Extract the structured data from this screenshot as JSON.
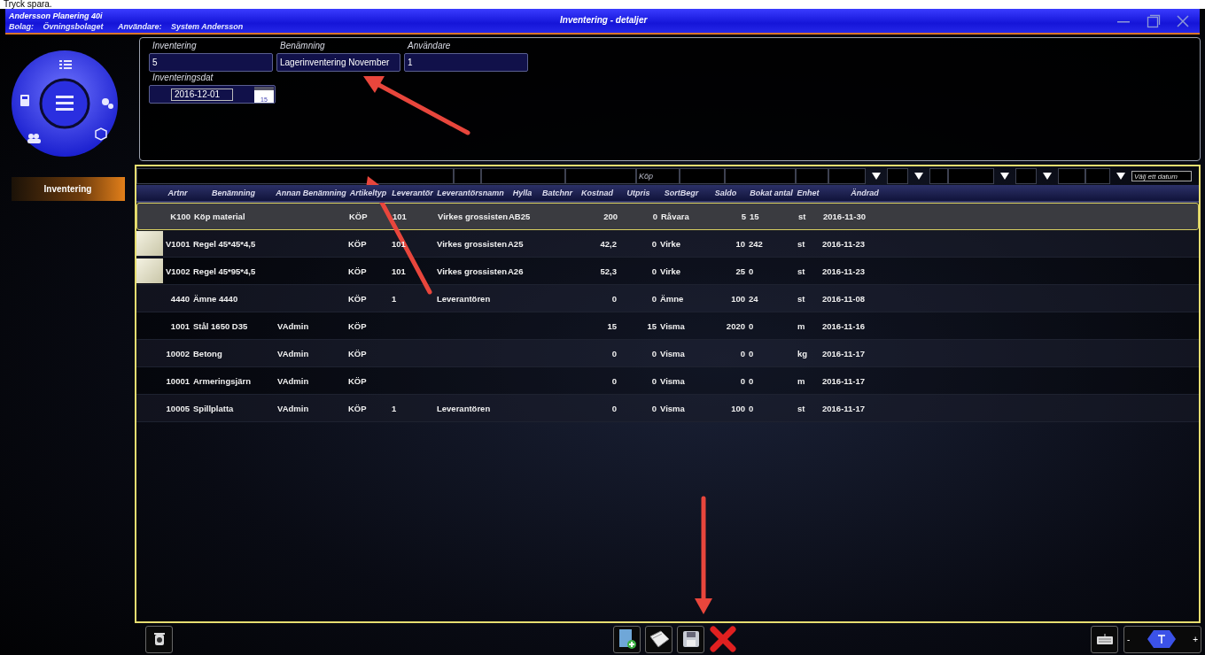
{
  "caption": "Tryck spara.",
  "window": {
    "app_name": "Andersson Planering 40i",
    "company_label": "Bolag:",
    "company": "Övningsbolaget",
    "user_label": "Användare:",
    "user": "System Andersson",
    "title": "Inventering - detaljer"
  },
  "sidebar": {
    "items": [
      {
        "label": "Inventering",
        "selected": true
      }
    ]
  },
  "form": {
    "fields": [
      {
        "label": "Inventering",
        "value": "5"
      },
      {
        "label": "Benämning",
        "value": "Lagerinventering November"
      },
      {
        "label": "Användare",
        "value": "1"
      }
    ],
    "date_field": {
      "label": "Inventeringsdat",
      "value": "2016-12-01",
      "calendar_day": "15"
    }
  },
  "table": {
    "columns": [
      {
        "label": "Artnr"
      },
      {
        "label": "Benämning"
      },
      {
        "label": "Annan Benämning"
      },
      {
        "label": "Artikeltyp"
      },
      {
        "label": "Leverantör"
      },
      {
        "label": "Leverantörsnamn"
      },
      {
        "label": "Hylla"
      },
      {
        "label": "Batchnr"
      },
      {
        "label": "Kostnad"
      },
      {
        "label": "Utpris"
      },
      {
        "label": "SortBegr"
      },
      {
        "label": "Saldo"
      },
      {
        "label": "Bokat antal"
      },
      {
        "label": "Enhet"
      },
      {
        "label": "Ändrad"
      }
    ],
    "filters": [
      {
        "dropdown": false
      },
      {
        "dropdown": false
      },
      {
        "dropdown": false
      },
      {
        "dropdown": false,
        "value": "Köp"
      },
      {
        "dropdown": false
      },
      {
        "dropdown": false
      },
      {
        "dropdown": false
      },
      {
        "dropdown": false
      },
      {
        "dropdown": true
      },
      {
        "dropdown": true
      },
      {
        "dropdown": false
      },
      {
        "dropdown": true
      },
      {
        "dropdown": true
      },
      {
        "dropdown": false
      },
      {
        "dropdown": true,
        "placeholder": "Välj ett datum"
      }
    ],
    "rows": [
      {
        "selected": true,
        "photo": false,
        "cells": [
          "K100",
          "Köp material",
          null,
          "KÖP",
          "101",
          "Virkes grossisten",
          "AB25",
          null,
          "200",
          "0",
          "Råvara",
          "5",
          "15",
          "st",
          "2016-11-30"
        ]
      },
      {
        "selected": false,
        "photo": true,
        "cells": [
          "V1001",
          "Regel 45*45*4,5",
          null,
          "KÖP",
          "101",
          "Virkes grossisten",
          "A25",
          null,
          "42,2",
          "0",
          "Virke",
          "10",
          "242",
          "st",
          "2016-11-23"
        ]
      },
      {
        "selected": false,
        "photo": true,
        "cells": [
          "V1002",
          "Regel 45*95*4,5",
          null,
          "KÖP",
          "101",
          "Virkes grossisten",
          "A26",
          null,
          "52,3",
          "0",
          "Virke",
          "25",
          "0",
          "st",
          "2016-11-23"
        ]
      },
      {
        "selected": false,
        "photo": false,
        "cells": [
          "4440",
          "Ämne 4440",
          null,
          "KÖP",
          "1",
          "Leverantören",
          null,
          null,
          "0",
          "0",
          "Ämne",
          "100",
          "24",
          "st",
          "2016-11-08"
        ]
      },
      {
        "selected": false,
        "photo": false,
        "cells": [
          "1001",
          "Stål 1650 D35",
          "VAdmin",
          "KÖP",
          null,
          null,
          null,
          null,
          "15",
          "15",
          "Visma",
          "2020",
          "0",
          "m",
          "2016-11-16"
        ]
      },
      {
        "selected": false,
        "photo": false,
        "cells": [
          "10002",
          "Betong",
          "VAdmin",
          "KÖP",
          null,
          null,
          null,
          null,
          "0",
          "0",
          "Visma",
          "0",
          "0",
          "kg",
          "2016-11-17"
        ]
      },
      {
        "selected": false,
        "photo": false,
        "cells": [
          "10001",
          "Armeringsjärn",
          "VAdmin",
          "KÖP",
          null,
          null,
          null,
          null,
          "0",
          "0",
          "Visma",
          "0",
          "0",
          "m",
          "2016-11-17"
        ]
      },
      {
        "selected": false,
        "photo": false,
        "cells": [
          "10005",
          "Spillplatta",
          "VAdmin",
          "KÖP",
          "1",
          "Leverantören",
          null,
          null,
          "0",
          "0",
          "Visma",
          "100",
          "0",
          "st",
          "2016-11-17"
        ]
      }
    ]
  },
  "zoom_control": {
    "minus": "-",
    "plus": "+"
  }
}
